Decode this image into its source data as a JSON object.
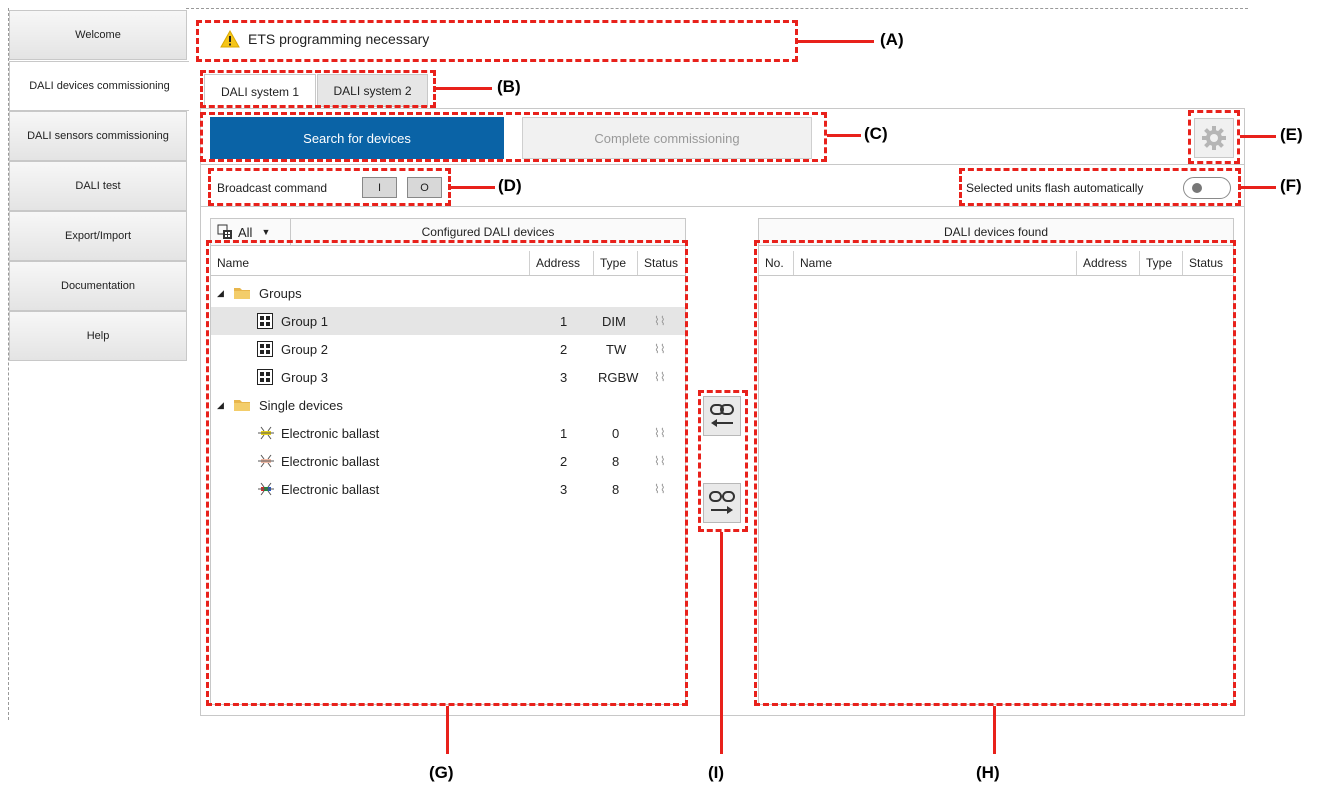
{
  "sidebar": {
    "items": [
      {
        "label": "Welcome"
      },
      {
        "label": "DALI devices commissioning"
      },
      {
        "label": "DALI sensors commissioning"
      },
      {
        "label": "DALI test"
      },
      {
        "label": "Export/Import"
      },
      {
        "label": "Documentation"
      },
      {
        "label": "Help"
      }
    ],
    "active_index": 1
  },
  "warning": {
    "text": "ETS programming necessary",
    "icon": "warning-icon"
  },
  "tabs": [
    {
      "label": "DALI system 1"
    },
    {
      "label": "DALI system 2"
    }
  ],
  "toolbar": {
    "search_label": "Search for devices",
    "complete_label": "Complete commissioning",
    "settings_icon": "gear-icon"
  },
  "broadcast": {
    "label": "Broadcast command",
    "on_label": "I",
    "off_label": "O"
  },
  "flash": {
    "label": "Selected units flash automatically",
    "enabled": false
  },
  "configured": {
    "filter_label": "All",
    "title": "Configured DALI devices",
    "columns": [
      "Name",
      "Address",
      "Type",
      "Status"
    ],
    "groups_label": "Groups",
    "groups": [
      {
        "name": "Group 1",
        "address": "1",
        "type": "DIM"
      },
      {
        "name": "Group 2",
        "address": "2",
        "type": "TW"
      },
      {
        "name": "Group 3",
        "address": "3",
        "type": "RGBW"
      }
    ],
    "singles_label": "Single devices",
    "singles": [
      {
        "name": "Electronic ballast",
        "address": "1",
        "type": "0"
      },
      {
        "name": "Electronic ballast",
        "address": "2",
        "type": "8"
      },
      {
        "name": "Electronic ballast",
        "address": "3",
        "type": "8"
      }
    ]
  },
  "found": {
    "title": "DALI devices found",
    "columns": [
      "No.",
      "Name",
      "Address",
      "Type",
      "Status"
    ]
  },
  "callouts": {
    "A": "(A)",
    "B": "(B)",
    "C": "(C)",
    "D": "(D)",
    "E": "(E)",
    "F": "(F)",
    "G": "(G)",
    "H": "(H)",
    "I": "(I)"
  },
  "colors": {
    "accent": "#0a63a6",
    "annotation": "#e8211b"
  }
}
